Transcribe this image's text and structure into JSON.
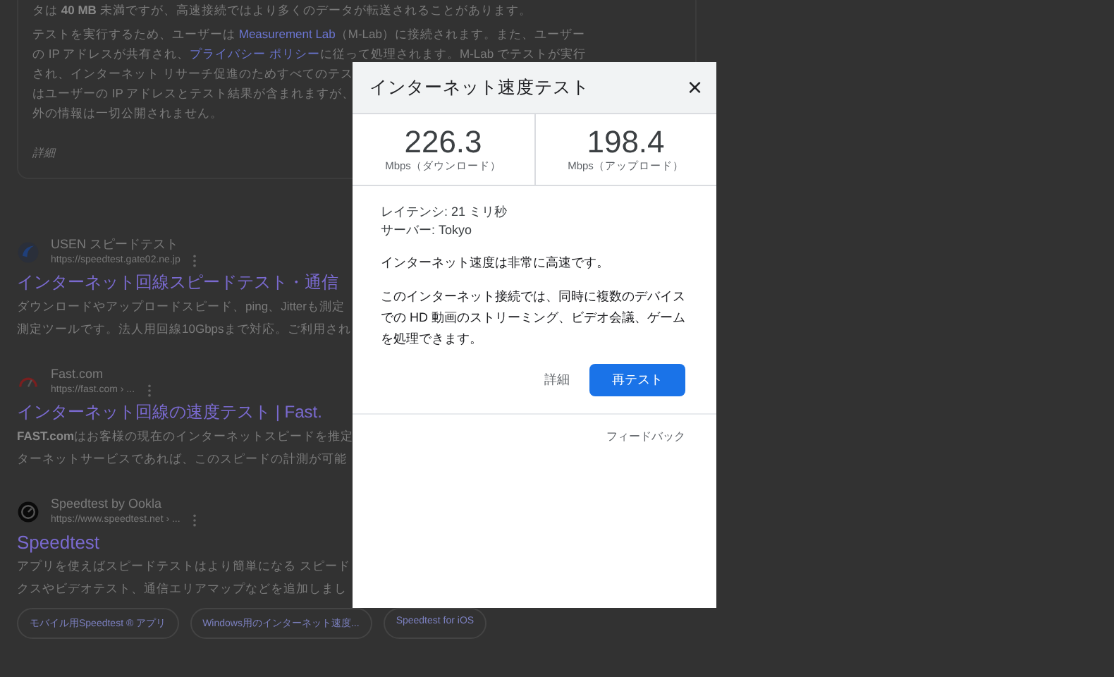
{
  "background": {
    "info_card": {
      "lines": [
        [
          {
            "kind": "text",
            "text": "タは "
          },
          {
            "kind": "bold",
            "text": "40 MB"
          },
          {
            "kind": "text",
            "text": " 未満ですが、高速接続ではより多くのデータが転送されることがあります。"
          }
        ],
        [
          {
            "kind": "text",
            "text": "テストを実行するため、ユーザーは "
          },
          {
            "kind": "link",
            "text": "Measurement Lab"
          },
          {
            "kind": "text",
            "text": "（M-Lab）に接続されます。また、ユーザー"
          }
        ],
        [
          {
            "kind": "text",
            "text": "の IP アドレスが共有され、"
          },
          {
            "kind": "link",
            "text": "プライバシー ポリシー"
          },
          {
            "kind": "text",
            "text": "に従って処理されます。M-Lab でテストが実行"
          }
        ],
        [
          {
            "kind": "text",
            "text": "され、インターネット リサーチ促進のためすべてのテス"
          }
        ],
        [
          {
            "kind": "text",
            "text": "はユーザーの IP アドレスとテスト結果が含まれますが、"
          }
        ],
        [
          {
            "kind": "text",
            "text": "外の情報は一切公開されません。"
          }
        ]
      ],
      "more_link": "詳細"
    },
    "results": [
      {
        "site_name": "USEN スピードテスト",
        "url": "https://speedtest.gate02.ne.jp",
        "title": "インターネット回線スピードテスト・通信",
        "snippet": [
          [
            {
              "kind": "text",
              "text": "ダウンロードやアップロードスピード、ping、Jitterも測定"
            }
          ],
          [
            {
              "kind": "text",
              "text": "測定ツールです。法人用回線10Gbpsまで対応。ご利用され"
            }
          ]
        ]
      },
      {
        "site_name": "Fast.com",
        "url": "https://fast.com › ...",
        "title": "インターネット回線の速度テスト | Fast.",
        "snippet": [
          [
            {
              "kind": "bold",
              "text": "FAST.com"
            },
            {
              "kind": "text",
              "text": "はお客様の現在のインターネットスピードを推定"
            }
          ],
          [
            {
              "kind": "text",
              "text": "ターネットサービスであれば、このスピードの計測が可能"
            }
          ]
        ]
      },
      {
        "site_name": "Speedtest by Ookla",
        "url": "https://www.speedtest.net › ...",
        "title": "Speedtest",
        "snippet": [
          [
            {
              "kind": "text",
              "text": "アプリを使えばスピードテストはより簡単になる スピード"
            }
          ],
          [
            {
              "kind": "text",
              "text": "クスやビデオテスト、通信エリアマップなどを追加しまし"
            }
          ]
        ],
        "chips": [
          "モバイル用Speedtest ® アプリ",
          "Windows用のインターネット速度...",
          "Speedtest for iOS"
        ]
      }
    ]
  },
  "dialog": {
    "title": "インターネット速度テスト",
    "close": "×",
    "results": [
      {
        "value": "226.3",
        "unit": "Mbps（ダウンロード）"
      },
      {
        "value": "198.4",
        "unit": "Mbps（アップロード）"
      }
    ],
    "latency": "レイテンシ: 21 ミリ秒",
    "server": "サーバー: Tokyo",
    "summary": "インターネット速度は非常に高速です。",
    "description": "このインターネット接続では、同時に複数のデバイスでの HD 動画のストリーミング、ビデオ会議、ゲームを処理できます。",
    "details_button": "詳細",
    "retest_button": "再テスト",
    "feedback": "フィードバック"
  }
}
